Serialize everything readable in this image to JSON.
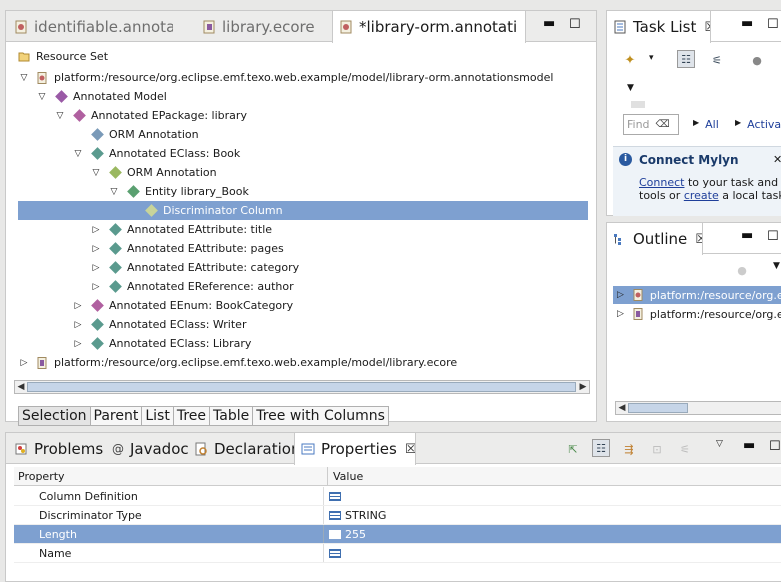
{
  "editor": {
    "tabs": [
      {
        "label": "identifiable.annotati"
      },
      {
        "label": "library.ecore"
      },
      {
        "label": "*library-orm.annotati"
      }
    ],
    "root_label": "Resource Set",
    "tree": [
      {
        "label": "platform:/resource/org.eclipse.emf.texo.web.example/model/library-orm.annotationsmodel"
      },
      {
        "label": "Annotated Model"
      },
      {
        "label": "Annotated EPackage: library"
      },
      {
        "label": "ORM Annotation"
      },
      {
        "label": "Annotated EClass: Book"
      },
      {
        "label": "ORM Annotation"
      },
      {
        "label": "Entity library_Book"
      },
      {
        "label": "Discriminator Column"
      },
      {
        "label": "Annotated EAttribute: title"
      },
      {
        "label": "Annotated EAttribute: pages"
      },
      {
        "label": "Annotated EAttribute: category"
      },
      {
        "label": "Annotated EReference: author"
      },
      {
        "label": "Annotated EEnum: BookCategory"
      },
      {
        "label": "Annotated EClass: Writer"
      },
      {
        "label": "Annotated EClass: Library"
      },
      {
        "label": "platform:/resource/org.eclipse.emf.texo.web.example/model/library.ecore"
      }
    ],
    "subtabs": [
      "Selection",
      "Parent",
      "List",
      "Tree",
      "Table",
      "Tree with Columns"
    ]
  },
  "tasklist": {
    "title": "Task List",
    "find_placeholder": "Find",
    "all_link": "All",
    "activate_link": "Activa...",
    "mylyn_title": "Connect Mylyn",
    "mylyn_connect": "Connect",
    "mylyn_text1": " to your task and ALM",
    "mylyn_text2": "tools or ",
    "mylyn_create": "create",
    "mylyn_text3": " a local task."
  },
  "outline": {
    "title": "Outline",
    "items": [
      {
        "label": "platform:/resource/org.ecli"
      },
      {
        "label": "platform:/resource/org.ecli"
      }
    ]
  },
  "bottom": {
    "tabs": [
      {
        "label": "Problems"
      },
      {
        "label": "Javadoc"
      },
      {
        "label": "Declaration"
      },
      {
        "label": "Properties"
      }
    ],
    "col_property": "Property",
    "col_value": "Value",
    "rows": [
      {
        "property": "Column Definition",
        "value": ""
      },
      {
        "property": "Discriminator Type",
        "value": "STRING"
      },
      {
        "property": "Length",
        "value": "255"
      },
      {
        "property": "Name",
        "value": ""
      }
    ]
  },
  "colors": {
    "selection": "#7ea0d0",
    "link": "#1f3f9a",
    "annotation_purple": "#9a5aa6",
    "annotation_teal": "#5a9a8e"
  }
}
